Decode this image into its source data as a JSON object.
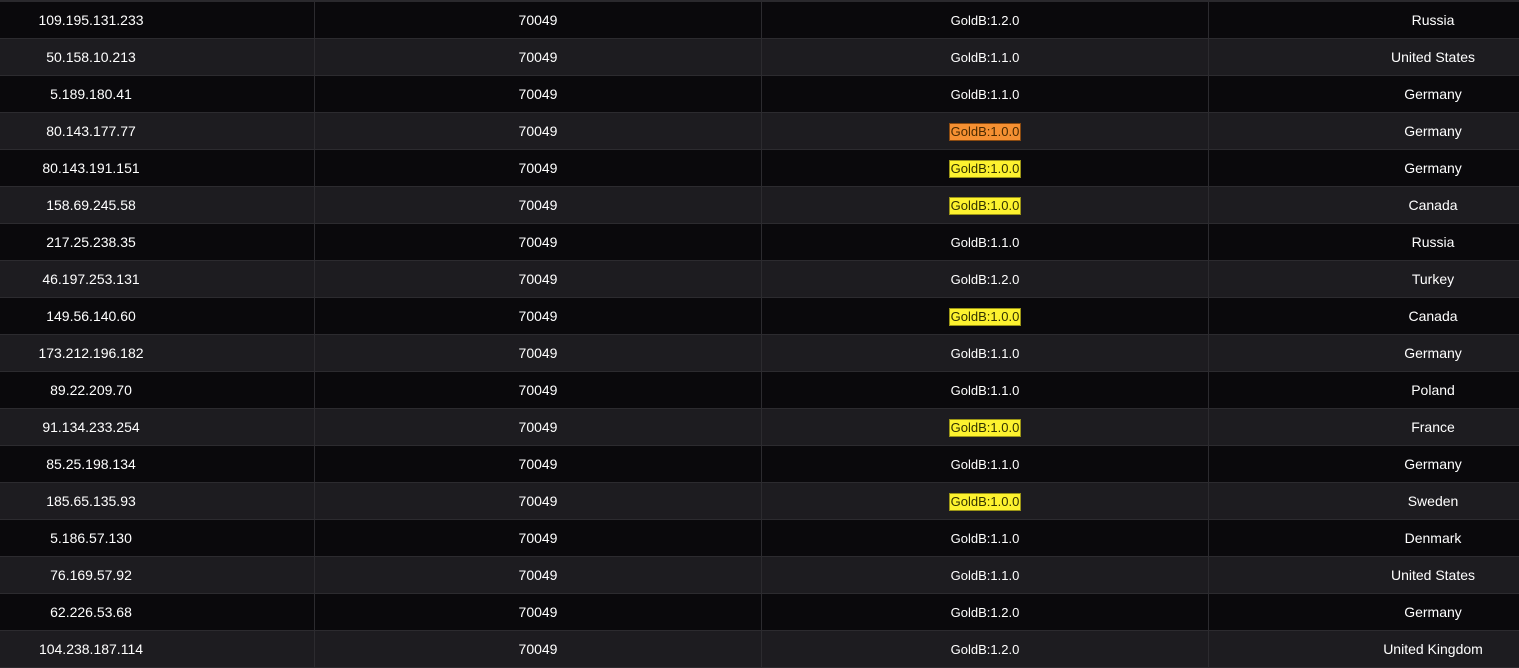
{
  "colors": {
    "row_dark": "#0a090c",
    "row_light": "#1d1c20",
    "highlight_orange": "#f59032",
    "highlight_yellow": "#fdf22f"
  },
  "rows": [
    {
      "ip": "109.195.131.233",
      "port": "70049",
      "version": "GoldB:1.2.0",
      "highlight": "none",
      "country": "Russia"
    },
    {
      "ip": "50.158.10.213",
      "port": "70049",
      "version": "GoldB:1.1.0",
      "highlight": "none",
      "country": "United States"
    },
    {
      "ip": "5.189.180.41",
      "port": "70049",
      "version": "GoldB:1.1.0",
      "highlight": "none",
      "country": "Germany"
    },
    {
      "ip": "80.143.177.77",
      "port": "70049",
      "version": "GoldB:1.0.0",
      "highlight": "orange",
      "country": "Germany"
    },
    {
      "ip": "80.143.191.151",
      "port": "70049",
      "version": "GoldB:1.0.0",
      "highlight": "yellow",
      "country": "Germany"
    },
    {
      "ip": "158.69.245.58",
      "port": "70049",
      "version": "GoldB:1.0.0",
      "highlight": "yellow",
      "country": "Canada"
    },
    {
      "ip": "217.25.238.35",
      "port": "70049",
      "version": "GoldB:1.1.0",
      "highlight": "none",
      "country": "Russia"
    },
    {
      "ip": "46.197.253.131",
      "port": "70049",
      "version": "GoldB:1.2.0",
      "highlight": "none",
      "country": "Turkey"
    },
    {
      "ip": "149.56.140.60",
      "port": "70049",
      "version": "GoldB:1.0.0",
      "highlight": "yellow",
      "country": "Canada"
    },
    {
      "ip": "173.212.196.182",
      "port": "70049",
      "version": "GoldB:1.1.0",
      "highlight": "none",
      "country": "Germany"
    },
    {
      "ip": "89.22.209.70",
      "port": "70049",
      "version": "GoldB:1.1.0",
      "highlight": "none",
      "country": "Poland"
    },
    {
      "ip": "91.134.233.254",
      "port": "70049",
      "version": "GoldB:1.0.0",
      "highlight": "yellow",
      "country": "France"
    },
    {
      "ip": "85.25.198.134",
      "port": "70049",
      "version": "GoldB:1.1.0",
      "highlight": "none",
      "country": "Germany"
    },
    {
      "ip": "185.65.135.93",
      "port": "70049",
      "version": "GoldB:1.0.0",
      "highlight": "yellow",
      "country": "Sweden"
    },
    {
      "ip": "5.186.57.130",
      "port": "70049",
      "version": "GoldB:1.1.0",
      "highlight": "none",
      "country": "Denmark"
    },
    {
      "ip": "76.169.57.92",
      "port": "70049",
      "version": "GoldB:1.1.0",
      "highlight": "none",
      "country": "United States"
    },
    {
      "ip": "62.226.53.68",
      "port": "70049",
      "version": "GoldB:1.2.0",
      "highlight": "none",
      "country": "Germany"
    },
    {
      "ip": "104.238.187.114",
      "port": "70049",
      "version": "GoldB:1.2.0",
      "highlight": "none",
      "country": "United Kingdom"
    }
  ]
}
